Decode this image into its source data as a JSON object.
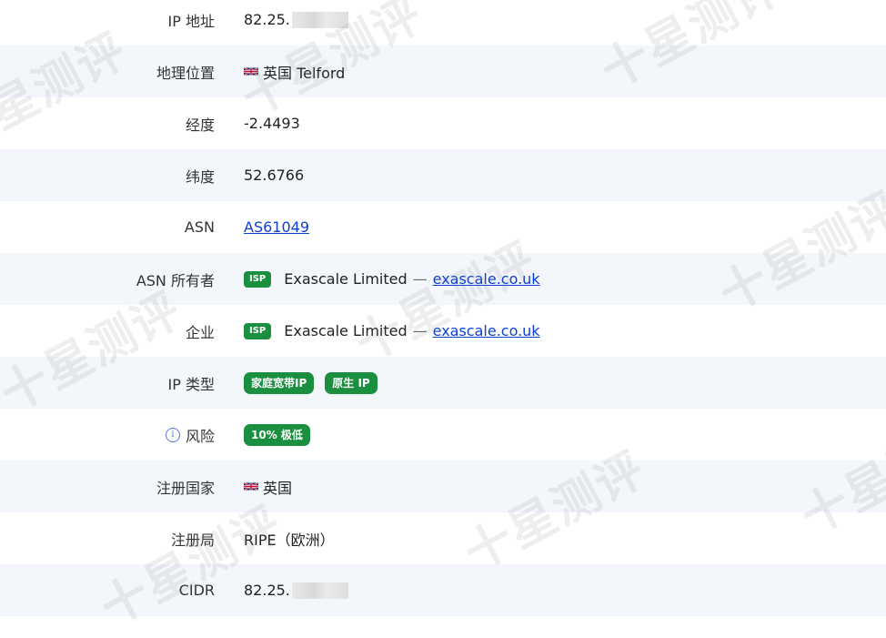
{
  "rows": [
    {
      "label": "IP 地址",
      "value": "82.25."
    },
    {
      "label": "地理位置",
      "value": "英国 Telford"
    },
    {
      "label": "经度",
      "value": "-2.4493"
    },
    {
      "label": "纬度",
      "value": "52.6766"
    },
    {
      "label": "ASN",
      "value": "AS61049"
    },
    {
      "label": "ASN 所有者",
      "isp": "ISP",
      "name": "Exascale Limited",
      "sep": "—",
      "link": "exascale.co.uk"
    },
    {
      "label": "企业",
      "isp": "ISP",
      "name": "Exascale Limited",
      "sep": "—",
      "link": "exascale.co.uk"
    },
    {
      "label": "IP 类型",
      "badges": [
        "家庭宽带IP",
        "原生 IP"
      ]
    },
    {
      "label": "风险",
      "badge": "10% 极低"
    },
    {
      "label": "注册国家",
      "value": "英国"
    },
    {
      "label": "注册局",
      "value": "RIPE（欧洲）"
    },
    {
      "label": "CIDR",
      "value": "82.25."
    }
  ],
  "icons": {
    "flag": "uk-flag-icon",
    "info": "info-icon"
  },
  "watermark": "十星测评",
  "colors": {
    "badge": "#1a8f3f",
    "link": "#0b3fd6",
    "alt_row": "#f3f6fb"
  }
}
